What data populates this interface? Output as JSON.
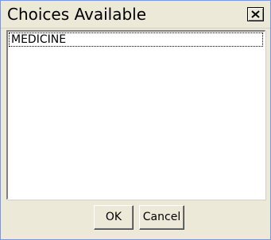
{
  "dialog": {
    "title": "Choices Available",
    "close_icon": "close-x-icon"
  },
  "list": {
    "items": [
      {
        "label": "MEDICINE",
        "focused": true
      }
    ]
  },
  "buttons": {
    "ok_label": "OK",
    "cancel_label": "Cancel"
  }
}
